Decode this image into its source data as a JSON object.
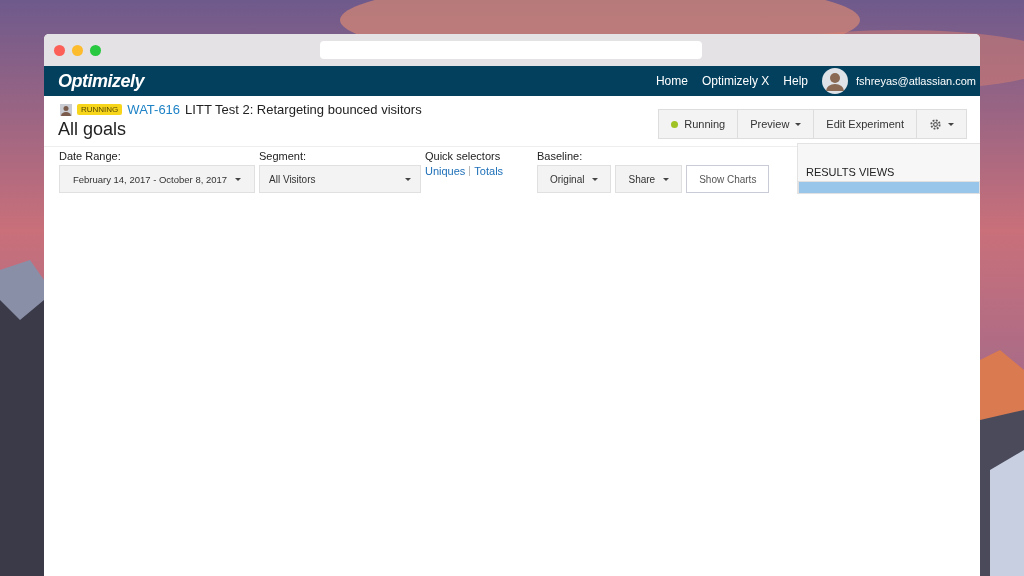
{
  "nav": {
    "logo": "Optimizely",
    "links": [
      {
        "label": "Home"
      },
      {
        "label": "Optimizely X"
      },
      {
        "label": "Help"
      }
    ],
    "user": "fshreyas@atlassian.com"
  },
  "experiment": {
    "status": "RUNNING",
    "key": "WAT-616",
    "name": "LITT Test 2: Retargeting bounced visitors",
    "view_title": "All goals"
  },
  "actions": {
    "state": "Running",
    "running": true,
    "preview": "Preview",
    "edit": "Edit Experiment"
  },
  "filters": {
    "date_range_label": "Date Range:",
    "date_range": "February 14, 2017 - October 8, 2017",
    "segment_label": "Segment:",
    "segment": "All Visitors",
    "quick_label": "Quick selectors",
    "quick": [
      {
        "label": "Uniques"
      },
      {
        "label": "Totals"
      }
    ],
    "baseline_label": "Baseline:",
    "baseline": "Original",
    "share": "Share",
    "show_charts": "Show Charts"
  },
  "sidebar": {
    "title": "RESULTS VIEWS",
    "items": [
      {
        "selected": true
      }
    ]
  }
}
